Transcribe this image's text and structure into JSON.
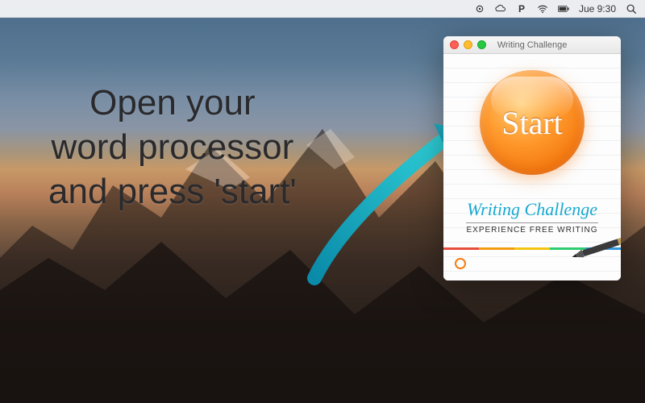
{
  "menubar": {
    "time": "Jue 9:30"
  },
  "instruction": {
    "line1": "Open your",
    "line2": "word processor",
    "line3": "and press 'start'"
  },
  "window": {
    "title": "Writing Challenge",
    "start_label": "Start",
    "brand_title": "Writing Challenge",
    "brand_sub": "EXPERIENCE FREE WRITING"
  }
}
